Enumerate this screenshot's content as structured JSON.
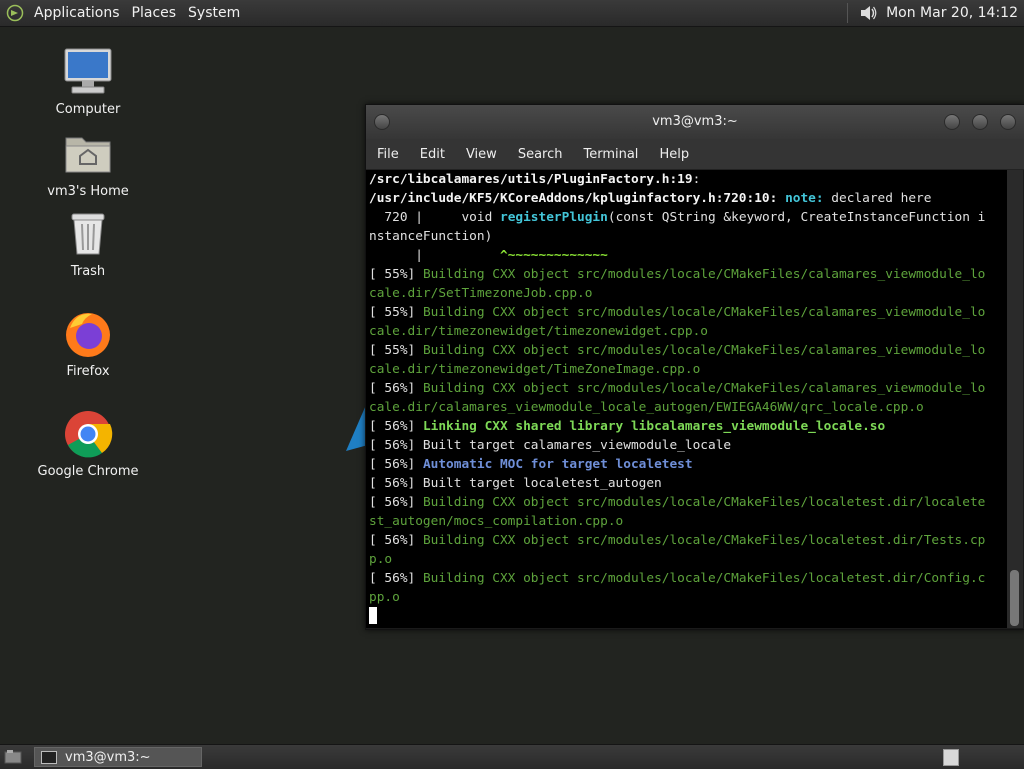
{
  "top_panel": {
    "menus": [
      "Applications",
      "Places",
      "System"
    ],
    "clock": "Mon Mar 20, 14:12"
  },
  "desktop": {
    "icons": [
      {
        "label": "Computer",
        "icon": "computer-icon"
      },
      {
        "label": "vm3's Home",
        "icon": "home-folder-icon"
      },
      {
        "label": "Trash",
        "icon": "trash-icon"
      },
      {
        "label": "Firefox",
        "icon": "firefox-icon"
      },
      {
        "label": "Google Chrome",
        "icon": "chrome-icon"
      }
    ]
  },
  "terminal": {
    "title": "vm3@vm3:~",
    "menu": [
      "File",
      "Edit",
      "View",
      "Search",
      "Terminal",
      "Help"
    ],
    "lines": [
      [
        {
          "t": "/src/libcalamares/utils/PluginFactory.h:19",
          "c": "b"
        },
        {
          "t": ":",
          "c": ""
        }
      ],
      [
        {
          "t": "/usr/include/KF5/KCoreAddons/kpluginfactory.h:720:10:",
          "c": "b"
        },
        {
          "t": " ",
          "c": ""
        },
        {
          "t": "note:",
          "c": "cy"
        },
        {
          "t": " declared here",
          "c": ""
        }
      ],
      [
        {
          "t": "  720 |     void ",
          "c": ""
        },
        {
          "t": "registerPlugin",
          "c": "cy"
        },
        {
          "t": "(const QString &keyword, CreateInstanceFunction i",
          "c": ""
        }
      ],
      [
        {
          "t": "nstanceFunction)",
          "c": ""
        }
      ],
      [
        {
          "t": "      |          ",
          "c": ""
        },
        {
          "t": "^~~~~~~~~~~~~~",
          "c": "gl"
        }
      ],
      [
        {
          "t": "[ 55%] ",
          "c": ""
        },
        {
          "t": "Building CXX object src/modules/locale/CMakeFiles/calamares_viewmodule_lo",
          "c": "g"
        }
      ],
      [
        {
          "t": "cale.dir/SetTimezoneJob.cpp.o",
          "c": "g"
        }
      ],
      [
        {
          "t": "[ 55%] ",
          "c": ""
        },
        {
          "t": "Building CXX object src/modules/locale/CMakeFiles/calamares_viewmodule_lo",
          "c": "g"
        }
      ],
      [
        {
          "t": "cale.dir/timezonewidget/timezonewidget.cpp.o",
          "c": "g"
        }
      ],
      [
        {
          "t": "[ 55%] ",
          "c": ""
        },
        {
          "t": "Building CXX object src/modules/locale/CMakeFiles/calamares_viewmodule_lo",
          "c": "g"
        }
      ],
      [
        {
          "t": "cale.dir/timezonewidget/TimeZoneImage.cpp.o",
          "c": "g"
        }
      ],
      [
        {
          "t": "[ 56%] ",
          "c": ""
        },
        {
          "t": "Building CXX object src/modules/locale/CMakeFiles/calamares_viewmodule_lo",
          "c": "g"
        }
      ],
      [
        {
          "t": "cale.dir/calamares_viewmodule_locale_autogen/EWIEGA46WW/qrc_locale.cpp.o",
          "c": "g"
        }
      ],
      [
        {
          "t": "[ 56%] ",
          "c": ""
        },
        {
          "t": "Linking CXX shared library libcalamares_viewmodule_locale.so",
          "c": "bg"
        }
      ],
      [
        {
          "t": "[ 56%] Built target calamares_viewmodule_locale",
          "c": ""
        }
      ],
      [
        {
          "t": "[ 56%] ",
          "c": ""
        },
        {
          "t": "Automatic MOC for target localetest",
          "c": "bb"
        }
      ],
      [
        {
          "t": "[ 56%] Built target localetest_autogen",
          "c": ""
        }
      ],
      [
        {
          "t": "[ 56%] ",
          "c": ""
        },
        {
          "t": "Building CXX object src/modules/locale/CMakeFiles/localetest.dir/localete",
          "c": "g"
        }
      ],
      [
        {
          "t": "st_autogen/mocs_compilation.cpp.o",
          "c": "g"
        }
      ],
      [
        {
          "t": "[ 56%] ",
          "c": ""
        },
        {
          "t": "Building CXX object src/modules/locale/CMakeFiles/localetest.dir/Tests.cp",
          "c": "g"
        }
      ],
      [
        {
          "t": "p.o",
          "c": "g"
        }
      ],
      [
        {
          "t": "[ 56%] ",
          "c": ""
        },
        {
          "t": "Building CXX object src/modules/locale/CMakeFiles/localetest.dir/Config.c",
          "c": "g"
        }
      ],
      [
        {
          "t": "pp.o",
          "c": "g"
        }
      ]
    ]
  },
  "taskbar": {
    "task_label": "vm3@vm3:~"
  }
}
